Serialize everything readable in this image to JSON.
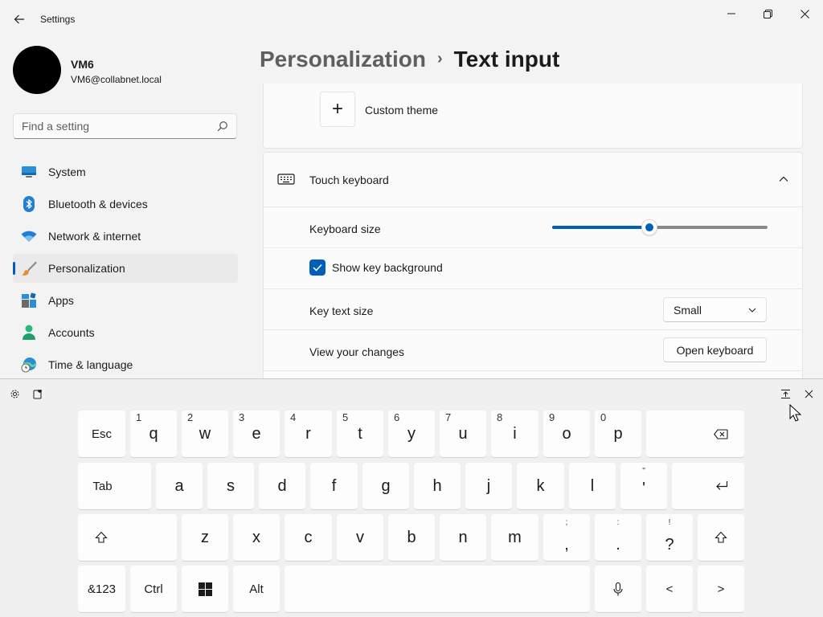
{
  "window": {
    "app_title": "Settings",
    "controls": [
      "minimize-icon",
      "maximize-icon",
      "close-icon"
    ]
  },
  "profile": {
    "name": "VM6",
    "email": "VM6@collabnet.local"
  },
  "search": {
    "placeholder": "Find a setting"
  },
  "nav": {
    "items": [
      {
        "label": "System",
        "icon": "monitor-icon"
      },
      {
        "label": "Bluetooth & devices",
        "icon": "bluetooth-icon"
      },
      {
        "label": "Network & internet",
        "icon": "wifi-icon"
      },
      {
        "label": "Personalization",
        "icon": "brush-icon",
        "selected": true
      },
      {
        "label": "Apps",
        "icon": "apps-icon"
      },
      {
        "label": "Accounts",
        "icon": "person-icon"
      },
      {
        "label": "Time & language",
        "icon": "globe-clock-icon"
      }
    ]
  },
  "breadcrumb": {
    "parent": "Personalization",
    "separator": "›",
    "current": "Text input"
  },
  "theme_card": {
    "custom_theme_label": "Custom theme",
    "plus_symbol": "+"
  },
  "touch_keyboard": {
    "title": "Touch keyboard",
    "keyboard_size": {
      "label": "Keyboard size",
      "value_fraction": 0.45
    },
    "show_key_background": {
      "label": "Show key background",
      "checked": true
    },
    "key_text_size": {
      "label": "Key text size",
      "selected": "Small"
    },
    "view_changes": {
      "label": "View your changes",
      "button": "Open keyboard"
    }
  },
  "colors": {
    "accent": "#005fb8",
    "window_bg": "#f3f3f3",
    "card_bg": "#fbfbfb",
    "keyboard_bg": "#f0f0f0",
    "key_bg": "#fdfdfd"
  },
  "keyboard": {
    "toolbar": [
      "settings-icon",
      "emoji-icon",
      "dock-icon",
      "close-icon"
    ],
    "row1": [
      {
        "label": "Esc"
      },
      {
        "label": "q",
        "num": "1"
      },
      {
        "label": "w",
        "num": "2"
      },
      {
        "label": "e",
        "num": "3"
      },
      {
        "label": "r",
        "num": "4"
      },
      {
        "label": "t",
        "num": "5"
      },
      {
        "label": "y",
        "num": "6"
      },
      {
        "label": "u",
        "num": "7"
      },
      {
        "label": "i",
        "num": "8"
      },
      {
        "label": "o",
        "num": "9"
      },
      {
        "label": "p",
        "num": "0"
      },
      {
        "label": "",
        "icon": "backspace-icon"
      }
    ],
    "row2": [
      {
        "label": "Tab"
      },
      {
        "label": "a"
      },
      {
        "label": "s"
      },
      {
        "label": "d"
      },
      {
        "label": "f"
      },
      {
        "label": "g"
      },
      {
        "label": "h"
      },
      {
        "label": "j"
      },
      {
        "label": "k"
      },
      {
        "label": "l"
      },
      {
        "label": "'",
        "sub": "\""
      },
      {
        "label": "",
        "icon": "enter-icon"
      }
    ],
    "row3": [
      {
        "label": "",
        "icon": "shift-icon"
      },
      {
        "label": "z"
      },
      {
        "label": "x"
      },
      {
        "label": "c"
      },
      {
        "label": "v"
      },
      {
        "label": "b"
      },
      {
        "label": "n"
      },
      {
        "label": "m"
      },
      {
        "label": ",",
        "sub": ";"
      },
      {
        "label": ".",
        "sub": ":"
      },
      {
        "label": "?",
        "sub": "!"
      },
      {
        "label": "",
        "icon": "shift-icon"
      }
    ],
    "row4": [
      {
        "label": "&123"
      },
      {
        "label": "Ctrl"
      },
      {
        "label": "",
        "icon": "windows-logo-icon"
      },
      {
        "label": "Alt"
      },
      {
        "label": "",
        "icon": "space-bar"
      },
      {
        "label": "",
        "icon": "microphone-icon"
      },
      {
        "label": "<"
      },
      {
        "label": ">"
      }
    ]
  }
}
